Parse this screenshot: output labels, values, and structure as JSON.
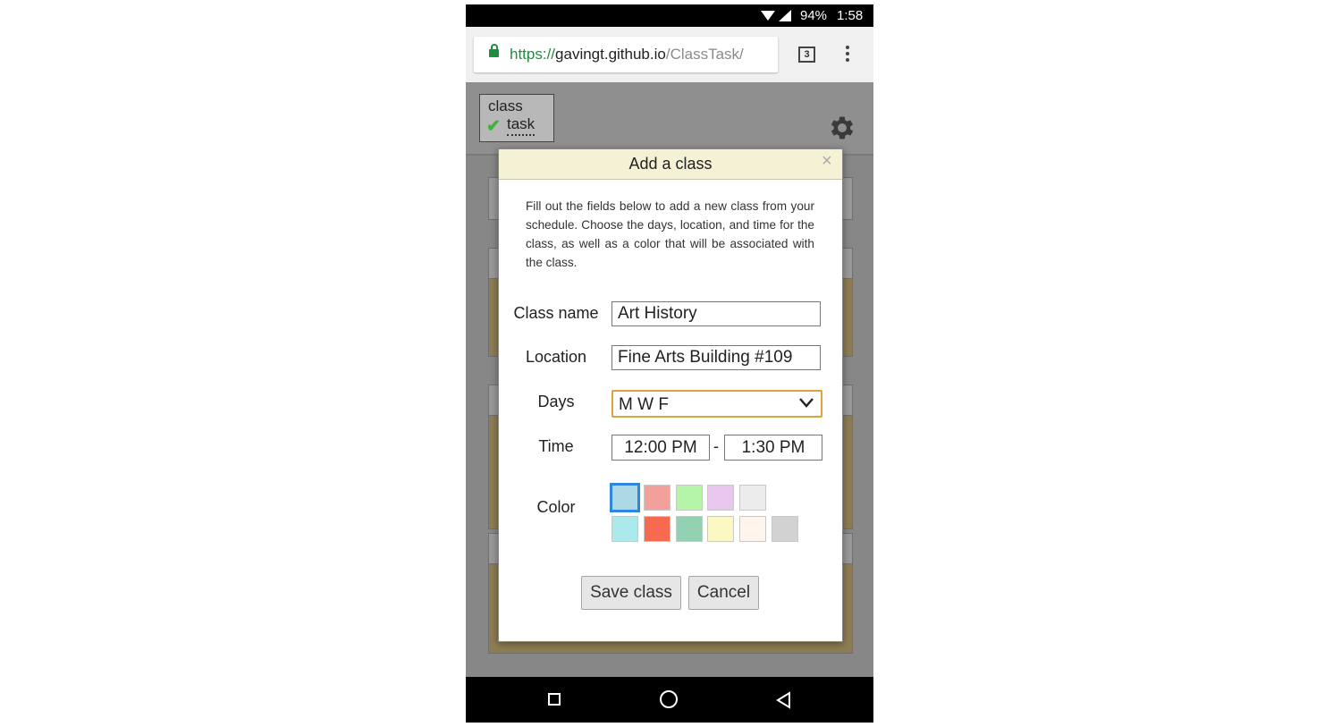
{
  "status_bar": {
    "battery": "94%",
    "time": "1:58"
  },
  "browser": {
    "url_scheme": "https://",
    "url_host": "gavingt.github.io",
    "url_path": "/ClassTask/",
    "tab_count": "3"
  },
  "app": {
    "logo_line1": "class",
    "logo_line2": "task"
  },
  "modal": {
    "title": "Add a class",
    "close_glyph": "×",
    "description": "Fill out the fields below to add a new class from your schedule. Choose the days, location, and time for the class, as well as a color that will be associated with the class.",
    "fields": {
      "class_name_label": "Class name",
      "class_name_value": "Art History",
      "location_label": "Location",
      "location_value": "Fine Arts Building #109",
      "days_label": "Days",
      "days_value": "M W F",
      "time_label": "Time",
      "time_start": "12:00 PM",
      "time_separator": "-",
      "time_end": "1:30 PM",
      "color_label": "Color"
    },
    "colors": {
      "row1": [
        "#add8e6",
        "#f4a09a",
        "#b5f5a8",
        "#e9c6ee",
        "#ececec"
      ],
      "row2": [
        "#ace9ec",
        "#f76a50",
        "#92d2b2",
        "#fcf8c4",
        "#fff4ee",
        "#d2d2d2"
      ],
      "selected": "#add8e6"
    },
    "buttons": {
      "save": "Save class",
      "cancel": "Cancel"
    }
  },
  "icons": [
    "wifi-icon",
    "signal-icon",
    "lock-icon",
    "tabs-icon",
    "menu-icon",
    "gear-icon",
    "close-icon",
    "chevron-down-icon",
    "nav-square-icon",
    "nav-circle-icon",
    "nav-back-icon"
  ]
}
